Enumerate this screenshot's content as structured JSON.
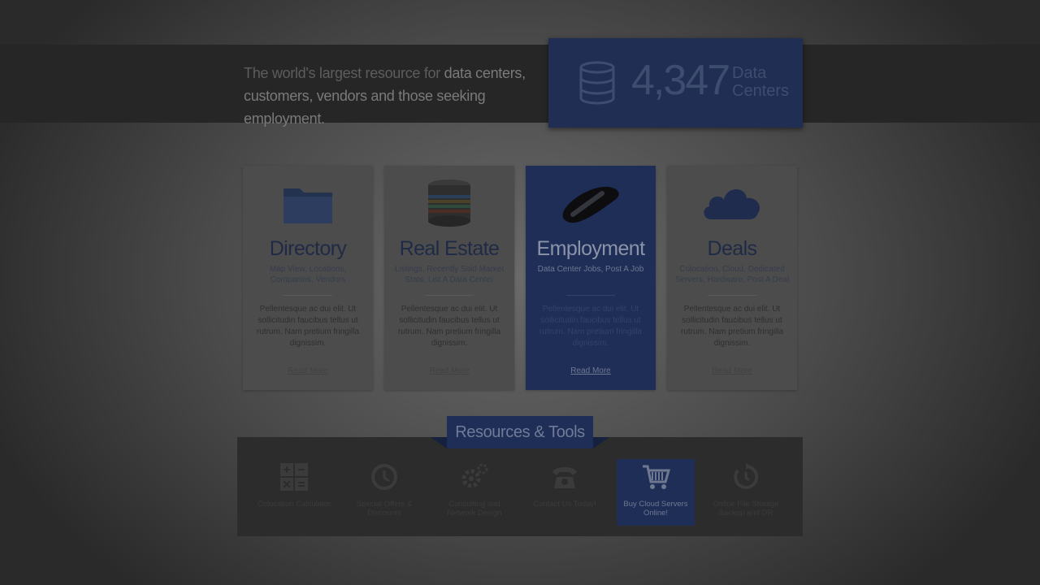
{
  "hero": {
    "tagline_plain": "The world's largest resource for ",
    "tagline_bold_1": "data centers,",
    "tagline_bold_2": "customers, vendors and those seeking employment.",
    "stat_number": "4,347",
    "stat_label_1": "Data",
    "stat_label_2": "Centers",
    "stat_icon": "database-icon"
  },
  "cards": [
    {
      "icon": "folder-icon",
      "title": "Directory",
      "subtitle": "Map View, Locations, Companies, Vendors",
      "body": "Pellentesque ac dui elit. Ut sollicitudin faucibus tellus ut rutrum. Nam pretium fringilla dignissim.",
      "link": "Read More",
      "active": false
    },
    {
      "icon": "server-stack-icon",
      "title": "Real Estate",
      "subtitle": "Listings, Recently Sold Market Stats, List A Data Center",
      "body": "Pellentesque ac dui elit. Ut sollicitudin faucibus tellus ut rutrum. Nam pretium fringilla dignissim.",
      "link": "Read More",
      "active": false
    },
    {
      "icon": "mouse-icon",
      "title": "Employment",
      "subtitle": "Data Center Jobs, Post A Job",
      "body": "Pellentesque ac dui elit. Ut sollicitudin faucibus tellus ut rutrum. Nam pretium fringilla dignissim.",
      "link": "Read More",
      "active": true
    },
    {
      "icon": "cloud-icon",
      "title": "Deals",
      "subtitle": "Colocation, Cloud, Dedicated Servers, Hardware, Post A Deal",
      "body": "Pellentesque ac dui elit. Ut sollicitudin faucibus tellus ut rutrum. Nam pretium fringilla dignissim.",
      "link": "Read More",
      "active": false
    }
  ],
  "resources": {
    "heading": "Resources & Tools",
    "items": [
      {
        "icon": "calculator-icon",
        "label": "Colocation Calculator",
        "active": false
      },
      {
        "icon": "clock-icon",
        "label": "Special Offers & Discounts",
        "active": false
      },
      {
        "icon": "gears-icon",
        "label": "Consulting and Network Design",
        "active": false
      },
      {
        "icon": "phone-icon",
        "label": "Contact Us Today!",
        "active": false
      },
      {
        "icon": "cart-icon",
        "label": "Buy Cloud Servers Online!",
        "active": true
      },
      {
        "icon": "backup-icon",
        "label": "Online File Storage Backup and DR",
        "active": false
      }
    ]
  },
  "colors": {
    "accent_blue": "#1f2e57",
    "overlay_dark": "#262626"
  }
}
